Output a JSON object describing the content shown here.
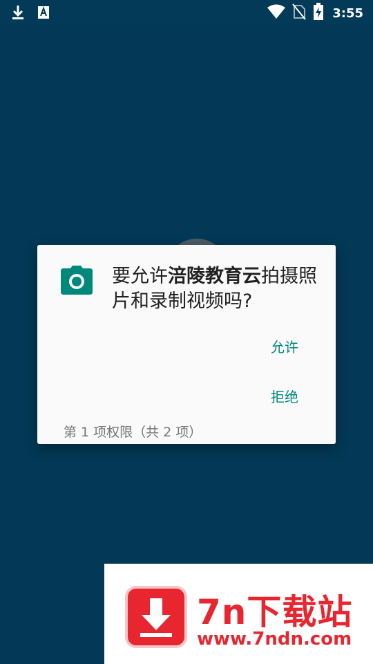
{
  "status_bar": {
    "time": "3:55",
    "left_icons": [
      "download-icon",
      "font-a-icon"
    ],
    "right_icons": [
      "wifi-icon",
      "no-sim-icon",
      "battery-charging-icon"
    ]
  },
  "dialog": {
    "icon": "camera-icon",
    "message_prefix": "要允许",
    "app_name": "涪陵教育云",
    "message_suffix": "拍摄照片和录制视频吗?",
    "allow_label": "允许",
    "deny_label": "拒绝",
    "footer": "第 1 项权限（共 2 项）"
  },
  "watermark": {
    "title": "7n下载站",
    "url": "www.7ndn.com",
    "icon": "download-arrow-icon"
  },
  "colors": {
    "background": "#04466a",
    "status_bar": "#023a58",
    "accent": "#00897b",
    "watermark_red": "#e8262f"
  }
}
